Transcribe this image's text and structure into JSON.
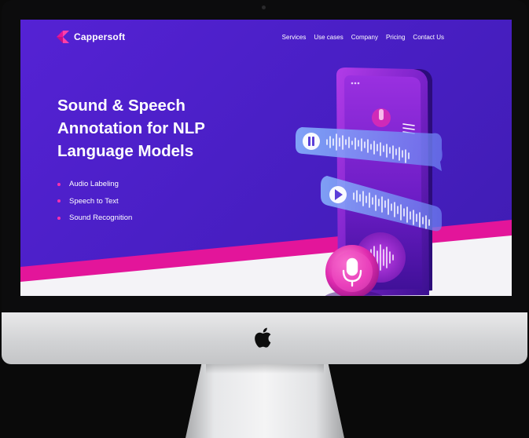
{
  "brand": {
    "name": "Cappersoft"
  },
  "nav": {
    "items": [
      {
        "label": "Services"
      },
      {
        "label": "Use cases"
      },
      {
        "label": "Company"
      },
      {
        "label": "Pricing"
      },
      {
        "label": "Contact Us"
      }
    ]
  },
  "hero": {
    "title_line1": "Sound & Speech",
    "title_line2": "Annotation for NLP",
    "title_line3": "Language Models",
    "bullets": [
      {
        "label": "Audio Labeling"
      },
      {
        "label": "Speech to Text"
      },
      {
        "label": "Sound Recognition"
      }
    ]
  },
  "icons": {
    "brand_logo": "cappersoft-logo-icon",
    "pause": "pause-icon",
    "play": "play-icon",
    "microphone": "microphone-icon",
    "menu": "hamburger-menu-icon",
    "device_logo": "apple-logo-icon"
  },
  "colors": {
    "background": "#4a1fc6",
    "accent_pink": "#e3159a",
    "bullet_dot": "#ff2fae",
    "text": "#ffffff",
    "bottom_band": "#f4f3f7"
  }
}
